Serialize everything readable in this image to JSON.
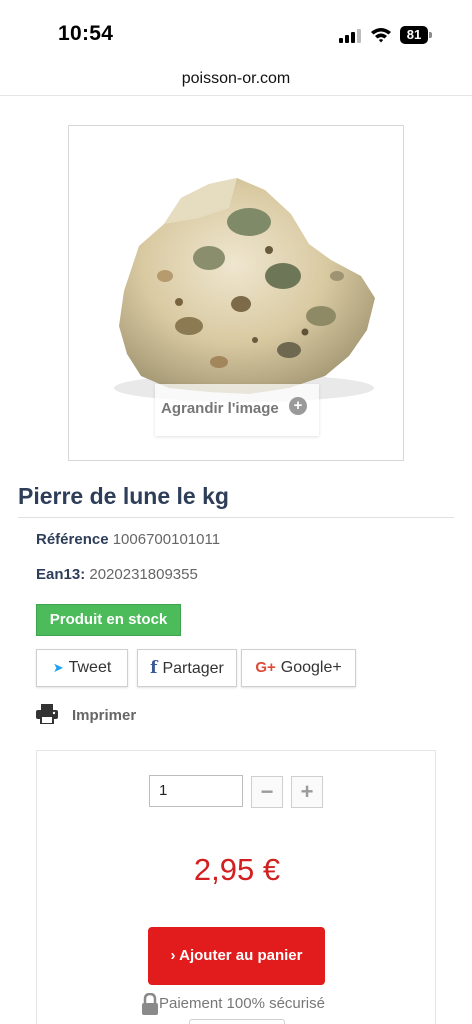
{
  "status_bar": {
    "time": "10:54",
    "battery": "81"
  },
  "browser": {
    "url": "poisson-or.com"
  },
  "product": {
    "image_zoom_label": "Agrandir l'image",
    "title": "Pierre de lune le kg",
    "reference_label": "Référence",
    "reference_value": "1006700101011",
    "ean_label": "Ean13:",
    "ean_value": "2020231809355",
    "stock_badge": "Produit en stock",
    "stock_color": "#4cbb5a"
  },
  "social": {
    "tweet_label": "Tweet",
    "share_label": "Partager",
    "google_label": "Google+",
    "google_icon_text": "G+"
  },
  "print_label": "Imprimer",
  "cart": {
    "quantity": "1",
    "minus_label": "−",
    "plus_label": "+",
    "price": "2,95 €",
    "price_color": "#d21f1f",
    "add_button_label": "› Ajouter au panier",
    "add_button_color": "#e21c1c",
    "secure_label": "Paiement 100% sécurisé"
  }
}
